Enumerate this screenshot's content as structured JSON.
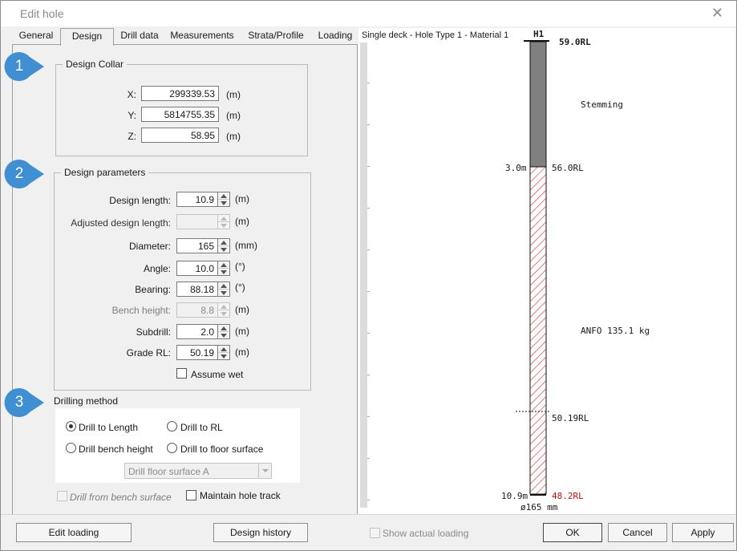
{
  "window": {
    "title": "Edit hole",
    "close_glyph": "✕"
  },
  "tabs": [
    {
      "label": "General"
    },
    {
      "label": "Design"
    },
    {
      "label": "Drill data"
    },
    {
      "label": "Measurements"
    },
    {
      "label": "Strata/Profile"
    },
    {
      "label": "Loading"
    }
  ],
  "active_tab": "Design",
  "callouts": [
    "1",
    "2",
    "3"
  ],
  "collar": {
    "title": "Design Collar",
    "x_label": "X:",
    "x_value": "299339.53",
    "x_unit": "(m)",
    "y_label": "Y:",
    "y_value": "5814755.35",
    "y_unit": "(m)",
    "z_label": "Z:",
    "z_value": "58.95",
    "z_unit": "(m)"
  },
  "params": {
    "title": "Design parameters",
    "design_length": {
      "label": "Design length:",
      "value": "10.9",
      "unit": "(m)"
    },
    "adjusted_length": {
      "label": "Adjusted design length:",
      "value": "",
      "unit": "(m)"
    },
    "diameter": {
      "label": "Diameter:",
      "value": "165",
      "unit": "(mm)"
    },
    "angle": {
      "label": "Angle:",
      "value": "10.0",
      "unit": "(°)"
    },
    "bearing": {
      "label": "Bearing:",
      "value": "88.18",
      "unit": "(°)"
    },
    "bench_height": {
      "label": "Bench height:",
      "value": "8.8",
      "unit": "(m)"
    },
    "subdrill": {
      "label": "Subdrill:",
      "value": "2.0",
      "unit": "(m)"
    },
    "grade_rl": {
      "label": "Grade RL:",
      "value": "50.19",
      "unit": "(m)"
    },
    "assume_wet": {
      "label": "Assume wet",
      "checked": false
    }
  },
  "drilling": {
    "title": "Drilling method",
    "drill_to_length": "Drill to Length",
    "drill_to_rl": "Drill to RL",
    "drill_bench_height": "Drill bench height",
    "drill_floor_surface": "Drill to floor surface",
    "selected": "Drill to Length",
    "floor_surface_value": "Drill floor surface A",
    "drill_from_bench": "Drill from bench surface",
    "maintain_hole_track": "Maintain hole track"
  },
  "buttons": {
    "edit_loading": "Edit loading",
    "design_history": "Design history",
    "show_actual_loading": "Show actual loading",
    "ok": "OK",
    "cancel": "Cancel",
    "apply": "Apply"
  },
  "diagram": {
    "title": "Single deck - Hole Type 1 - Material 1",
    "hole_id": "H1",
    "top_rl": "59.0RL",
    "stemming_label": "Stemming",
    "deck_depth": "3.0m",
    "deck_rl": "56.0RL",
    "charge_label": "ANFO 135.1 kg",
    "grade_rl": "50.19RL",
    "toe_depth": "10.9m",
    "toe_rl": "48.2RL",
    "diameter": "ø165 mm",
    "colors": {
      "stemming": "#808080",
      "charge_hatch": "#e03030",
      "toe_rl": "#d01010"
    }
  }
}
